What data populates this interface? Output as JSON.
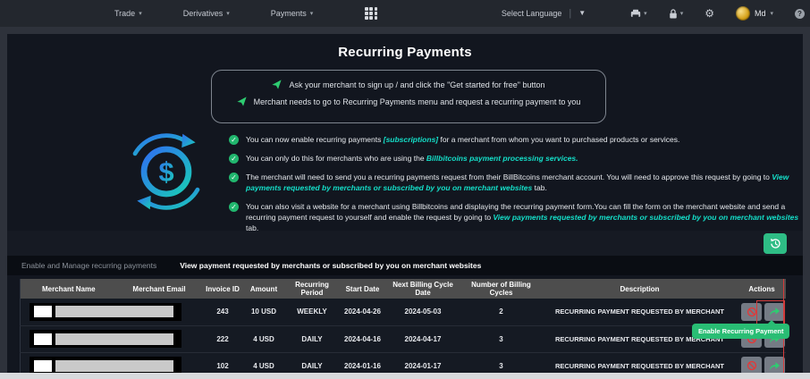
{
  "nav": {
    "items": [
      {
        "label": "Trade"
      },
      {
        "label": "Derivatives"
      },
      {
        "label": "Payments"
      }
    ],
    "language_label": "Select Language",
    "user_name": "Md",
    "help_label": "?",
    "icons": [
      "apps-grid-icon",
      "printer-icon",
      "lock-icon",
      "gear-icon",
      "help-icon"
    ]
  },
  "page": {
    "title": "Recurring Payments",
    "info_lines": [
      "Ask your merchant to sign up / and click the \"Get started for free\" button",
      "Merchant needs to go to Recurring Payments menu and request a recurring payment to you"
    ],
    "bullets": [
      {
        "pre": "You can now enable recurring payments ",
        "link": "[subscriptions]",
        "post": " for a merchant from whom you want to purchased products or services."
      },
      {
        "pre": "You can only do this for merchants who are using the ",
        "link": "Billbitcoins payment processing services.",
        "post": ""
      },
      {
        "pre": "The merchant will need to send you a recurring payments request from their BillBitcoins merchant account. You will need to approve this request by going to ",
        "link": "View payments requested by merchants or subscribed by you on merchant websites",
        "post": " tab."
      },
      {
        "pre": "You can also visit a website for a merchant using Billbitcoins and displaying the recurring payment form.You can fill the form on the merchant website and send a recurring payment request to yourself and enable the request by going to ",
        "link": "View payments requested by merchants or subscribed by you on merchant websites",
        "post": " tab."
      }
    ]
  },
  "tabs": [
    {
      "label": "Enable and Manage recurring payments",
      "active": false
    },
    {
      "label": "View payment requested by merchants or subscribed by you on merchant websites",
      "active": true
    }
  ],
  "table": {
    "headers": [
      "Merchant Name",
      "Merchant Email",
      "Invoice ID",
      "Amount",
      "Recurring Period",
      "Start Date",
      "Next Billing Cycle Date",
      "Number of Billing Cycles",
      "Description",
      "Actions"
    ],
    "rows": [
      {
        "merchant_redacted": true,
        "invoice_id": "243",
        "amount": "10 USD",
        "period": "WEEKLY",
        "start_date": "2024-04-26",
        "next_billing_date": "2024-05-03",
        "cycles": "2",
        "description": "RECURRING PAYMENT REQUESTED BY MERCHANT"
      },
      {
        "merchant_redacted": true,
        "invoice_id": "222",
        "amount": "4 USD",
        "period": "DAILY",
        "start_date": "2024-04-16",
        "next_billing_date": "2024-04-17",
        "cycles": "3",
        "description": "RECURRING PAYMENT REQUESTED BY MERCHANT"
      },
      {
        "merchant_redacted": true,
        "invoice_id": "102",
        "amount": "4 USD",
        "period": "DAILY",
        "start_date": "2024-01-16",
        "next_billing_date": "2024-01-17",
        "cycles": "3",
        "description": "RECURRING PAYMENT REQUESTED BY MERCHANT"
      }
    ],
    "action_icons": [
      "block-icon",
      "forward-arrow-icon"
    ]
  },
  "tooltip_label": "Enable Recurring Payment",
  "colors": {
    "accent_green": "#2ebd85",
    "link_cyan": "#14dfc9",
    "tooltip_green": "#29bd74",
    "annotation_red": "#d33b3b",
    "table_header_gray": "#4d4d4d",
    "panel_dark": "#12161f"
  }
}
